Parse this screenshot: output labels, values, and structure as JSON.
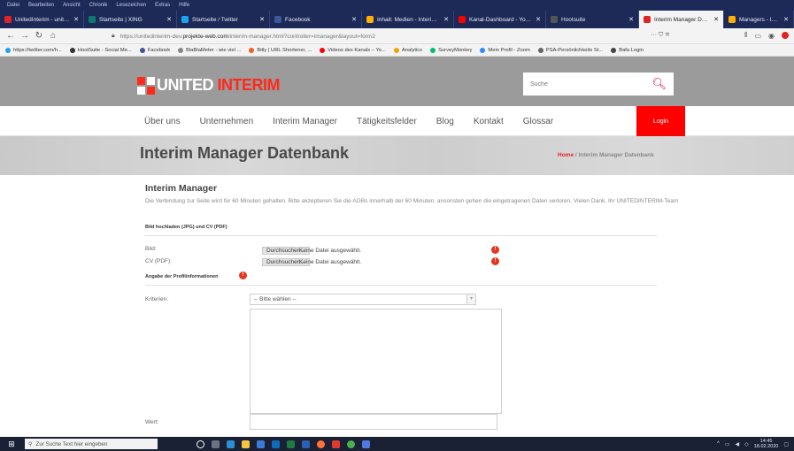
{
  "browser": {
    "menu": [
      "Datei",
      "Bearbeiten",
      "Ansicht",
      "Chronik",
      "Lesezeichen",
      "Extras",
      "Hilfe"
    ],
    "tabs": [
      {
        "label": "UnitedInterim - unitedinterim.",
        "color": "#e02424",
        "active": false
      },
      {
        "label": "Startseite | XING",
        "color": "#0a7a6f",
        "active": false
      },
      {
        "label": "Startseite / Twitter",
        "color": "#1da1f2",
        "active": false
      },
      {
        "label": "Facebook",
        "color": "#3b5998",
        "active": false
      },
      {
        "label": "Inhalt: Medien - Interim Ma",
        "color": "#ffb000",
        "active": false
      },
      {
        "label": "Kanal-Dashboard - YouTube",
        "color": "#ff0000",
        "active": false
      },
      {
        "label": "Hootsuite",
        "color": "#333333",
        "active": false
      },
      {
        "label": "Interim Manager Datenbank",
        "color": "#e02424",
        "active": true
      },
      {
        "label": "Managers - Interim Manage",
        "color": "#ffb000",
        "active": false
      }
    ],
    "url_prefix": "https://unitedinterim-dev.",
    "url_domain": "projekte-web.com",
    "url_suffix": "/interim-manager.html?controller=imanager&layout=form2",
    "url_tools": "··· ⛉ ☆",
    "bookmarks": [
      {
        "label": "https://twitter.com/h...",
        "color": "#1da1f2"
      },
      {
        "label": "HootSuite - Social Me...",
        "color": "#333333"
      },
      {
        "label": "Facebook",
        "color": "#3b5998"
      },
      {
        "label": "BlaBlaMeter - wie viel ...",
        "color": "#888888"
      },
      {
        "label": "Bitly | URL Shortener, ...",
        "color": "#ee6123"
      },
      {
        "label": "Videos des Kanals – Yo...",
        "color": "#ff0000"
      },
      {
        "label": "Analytics",
        "color": "#f4a400"
      },
      {
        "label": "SurveyMonkey",
        "color": "#00bf6f"
      },
      {
        "label": "Mein Profil - Zoom",
        "color": "#2d8cff"
      },
      {
        "label": "PSA-Persönlichkeits St...",
        "color": "#666666"
      },
      {
        "label": "Bafa Login",
        "color": "#444444"
      }
    ]
  },
  "site": {
    "logo_part1": "UNITED ",
    "logo_part2": "INTERIM",
    "search_placeholder": "Suche",
    "nav": [
      "Über uns",
      "Unternehmen",
      "Interim Manager",
      "Tätigkeitsfelder",
      "Blog",
      "Kontakt",
      "Glossar"
    ],
    "login_label": "Login",
    "page_title": "Interim Manager Datenbank",
    "breadcrumb_home": "Home",
    "breadcrumb_sep": " / ",
    "breadcrumb_current": "Interim Manager Datenbank",
    "accent": "#ff0000"
  },
  "form": {
    "heading": "Interim Manager",
    "note": "Die Verbindung zur Seite wird für 60 Minuten gehalten. Bitte akzeptieren Sie die AGBs innerhalb der 60 Minuten, ansonsten gehen die eingetragenen Daten verloren. Vielen Dank, Ihr UNITEDINTERIM-Team",
    "upload_section": "Bild hochladen (JPG) und CV (PDF)",
    "bild_label": "Bild:",
    "cv_label": "CV (PDF):",
    "browse_label": "Durchsuchen...",
    "no_file": "Keine Datei ausgewählt.",
    "profile_section": "Angabe der Profilinformationen",
    "kriterien_label": "Kriterien:",
    "kriterien_value": "-- Bitte wählen --",
    "wert_label": "Wert:"
  },
  "taskbar": {
    "search_placeholder": "Zur Suche Text hier eingeben",
    "time": "14:45",
    "date": "18.02.2020"
  }
}
